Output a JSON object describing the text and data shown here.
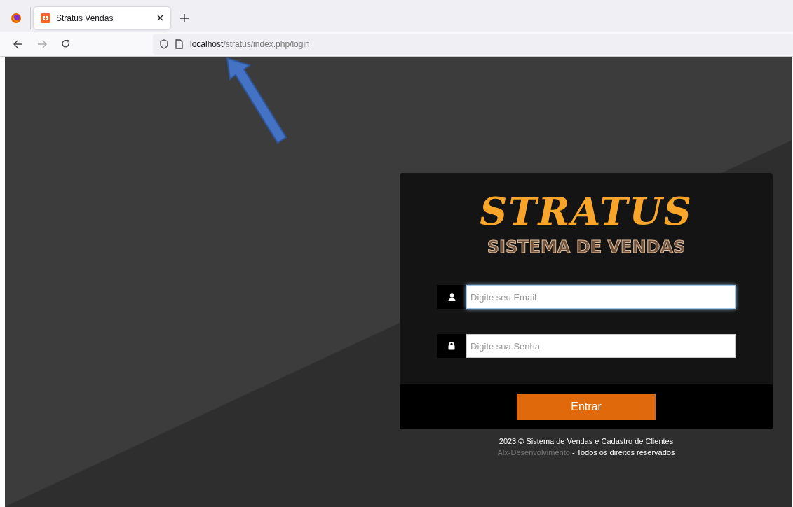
{
  "browser": {
    "tabs": [
      {
        "title": "Stratus Vendas",
        "selected": true
      }
    ],
    "url": {
      "host": "localhost",
      "path": "/stratus/index.php/login"
    }
  },
  "login": {
    "logo": "STRATUS",
    "subtitle": "SISTEMA DE VENDAS",
    "fields": [
      {
        "kind": "user",
        "placeholder": "Digite seu Email",
        "focused": true
      },
      {
        "kind": "lock",
        "placeholder": "Digite sua Senha",
        "focused": false
      }
    ],
    "button": "Entrar"
  },
  "footer": {
    "line": "2023 © Sistema de Vendas e Cadastro de Clientes",
    "author": "Alx-Desenvolvimento",
    "rights": " - Todos os direitos reservados"
  }
}
